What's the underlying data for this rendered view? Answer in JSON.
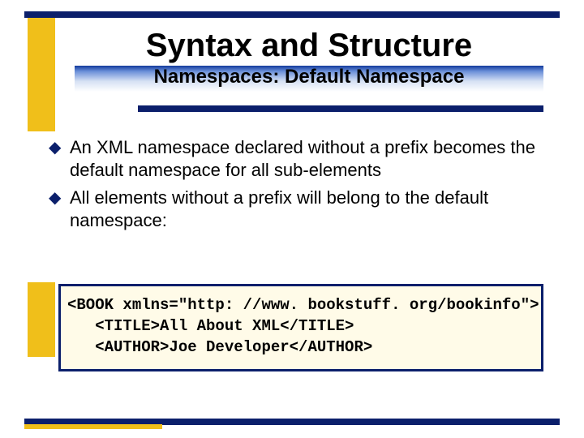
{
  "colors": {
    "accent_navy": "#0b1f6b",
    "accent_gold": "#f0bf1a"
  },
  "title": "Syntax and Structure",
  "subtitle": "Namespaces: Default Namespace",
  "bullets": [
    "An XML namespace declared without a prefix becomes the default namespace for all sub-elements",
    "All elements without a prefix will belong to the default namespace:"
  ],
  "code_lines": [
    "<BOOK xmlns=\"http: //www. bookstuff. org/bookinfo\">",
    "   <TITLE>All About XML</TITLE>",
    "   <AUTHOR>Joe Developer</AUTHOR>"
  ]
}
